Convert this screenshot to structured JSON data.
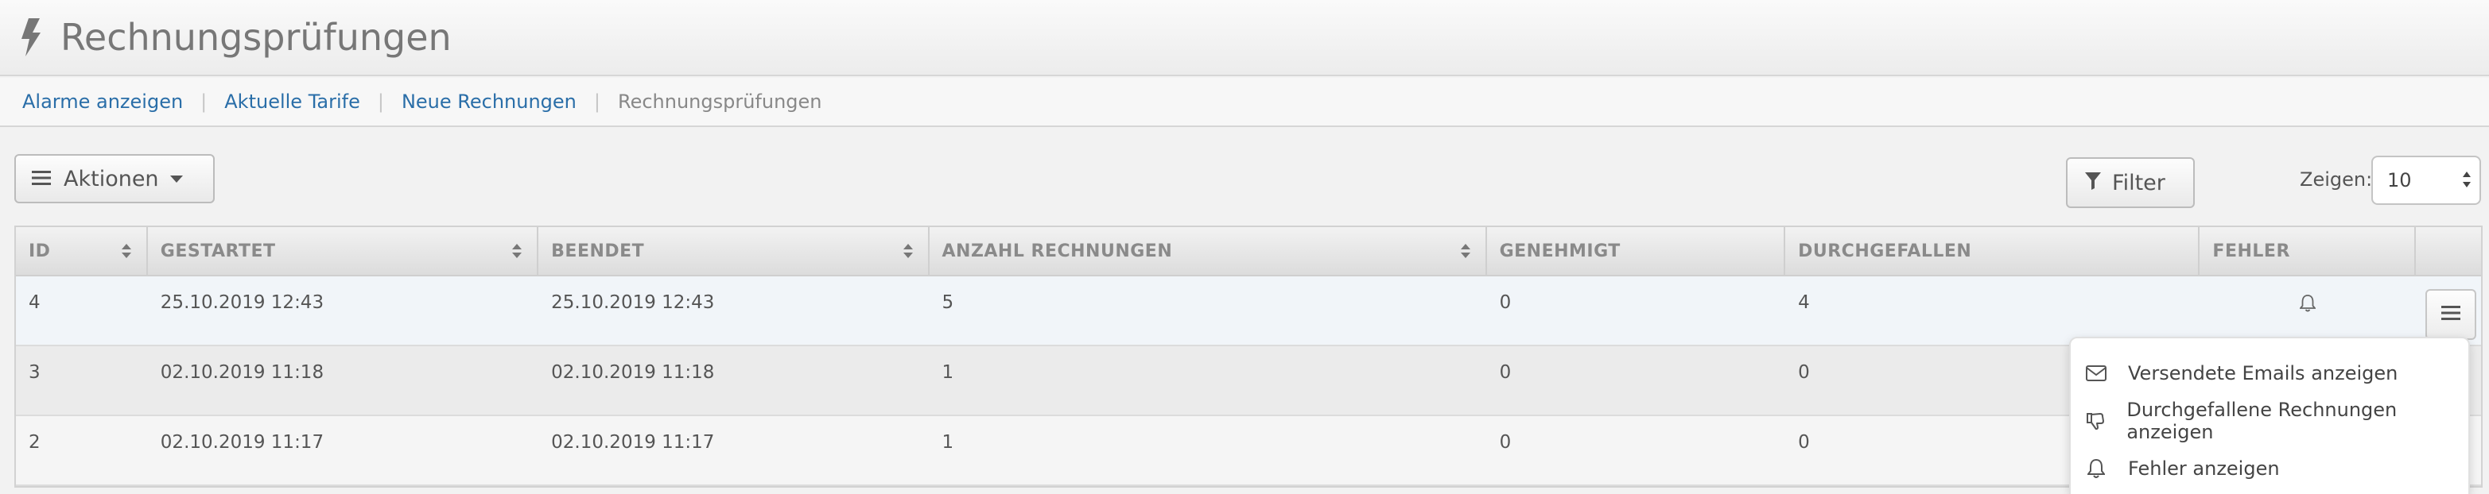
{
  "page": {
    "title": "Rechnungsprüfungen",
    "title_icon": "bolt-icon"
  },
  "breadcrumb": {
    "items": [
      {
        "label": "Alarme anzeigen"
      },
      {
        "label": "Aktuelle Tarife"
      },
      {
        "label": "Neue Rechnungen"
      }
    ],
    "current": "Rechnungsprüfungen"
  },
  "toolbar": {
    "actions_label": "Aktionen",
    "filter_label": "Filter",
    "show_label": "Zeigen:",
    "show_value": "10"
  },
  "table": {
    "columns": [
      "ID",
      "GESTARTET",
      "BEENDET",
      "ANZAHL RECHNUNGEN",
      "GENEHMIGT",
      "DURCHGEFALLEN",
      "FEHLER",
      ""
    ],
    "rows": [
      {
        "id": "4",
        "started": "25.10.2019 12:43",
        "ended": "25.10.2019 12:43",
        "invoices": "5",
        "approved": "0",
        "failed": "4",
        "has_error": true
      },
      {
        "id": "3",
        "started": "02.10.2019 11:18",
        "ended": "02.10.2019 11:18",
        "invoices": "1",
        "approved": "0",
        "failed": "0",
        "has_error": false
      },
      {
        "id": "2",
        "started": "02.10.2019 11:17",
        "ended": "02.10.2019 11:17",
        "invoices": "1",
        "approved": "0",
        "failed": "0",
        "has_error": false
      }
    ]
  },
  "row_menu": {
    "items": [
      {
        "label": "Versendete Emails anzeigen",
        "icon": "envelope-icon"
      },
      {
        "label": "Durchgefallene Rechnungen anzeigen",
        "icon": "thumbs-down-icon"
      },
      {
        "label": "Fehler anzeigen",
        "icon": "bell-icon"
      }
    ]
  },
  "colors": {
    "link": "#2a6ea8",
    "header_bg": "#ececec",
    "selected_row": "#f1f5f9"
  }
}
